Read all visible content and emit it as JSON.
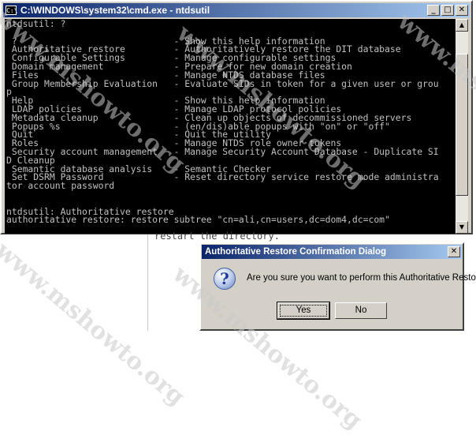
{
  "window": {
    "icon_label": "C:\\",
    "title": "C:\\WINDOWS\\system32\\cmd.exe - ntdsutil",
    "buttons": {
      "minimize": "_",
      "maximize": "□",
      "close": "✕"
    }
  },
  "console": {
    "text": "ntdsutil: ?\n\n ?                             - Show this help information\n Authoritative restore         - Authoritatively restore the DIT database\n Configurable Settings         - Manage configurable settings\n Domain management             - Prepare for new domain creation\n Files                         - Manage NTDS database files\n Group Membership Evaluation   - Evaluate SIDs in token for a given user or grou\np\n Help                          - Show this help information\n LDAP policies                 - Manage LDAP protocol policies\n Metadata cleanup              - Clean up objects of decommissioned servers\n Popups %s                     - (en/dis)able popups with \"on\" or \"off\"\n Quit                          - Quit the utility\n Roles                         - Manage NTDS role owner tokens\n Security account management   - Manage Security Account Database - Duplicate SI\nD Cleanup\n Semantic database analysis    - Semantic Checker\n Set DSRM Password             - Reset directory service restore mode administra\ntor account password\n\n\nntdsutil: Authoritative restore\nauthoritative restore: restore subtree \"cn=ali,cn=users,dc=dom4,dc=com\""
  },
  "background_text": "restart the directory.",
  "dialog": {
    "title": "Authoritative Restore Confirmation Dialog",
    "close": "✕",
    "icon": "question-icon",
    "message": "Are you sure you want to perform this Authoritative Restore?",
    "yes_label": "Yes",
    "no_label": "No"
  },
  "watermark": "www.mshowto.org"
}
